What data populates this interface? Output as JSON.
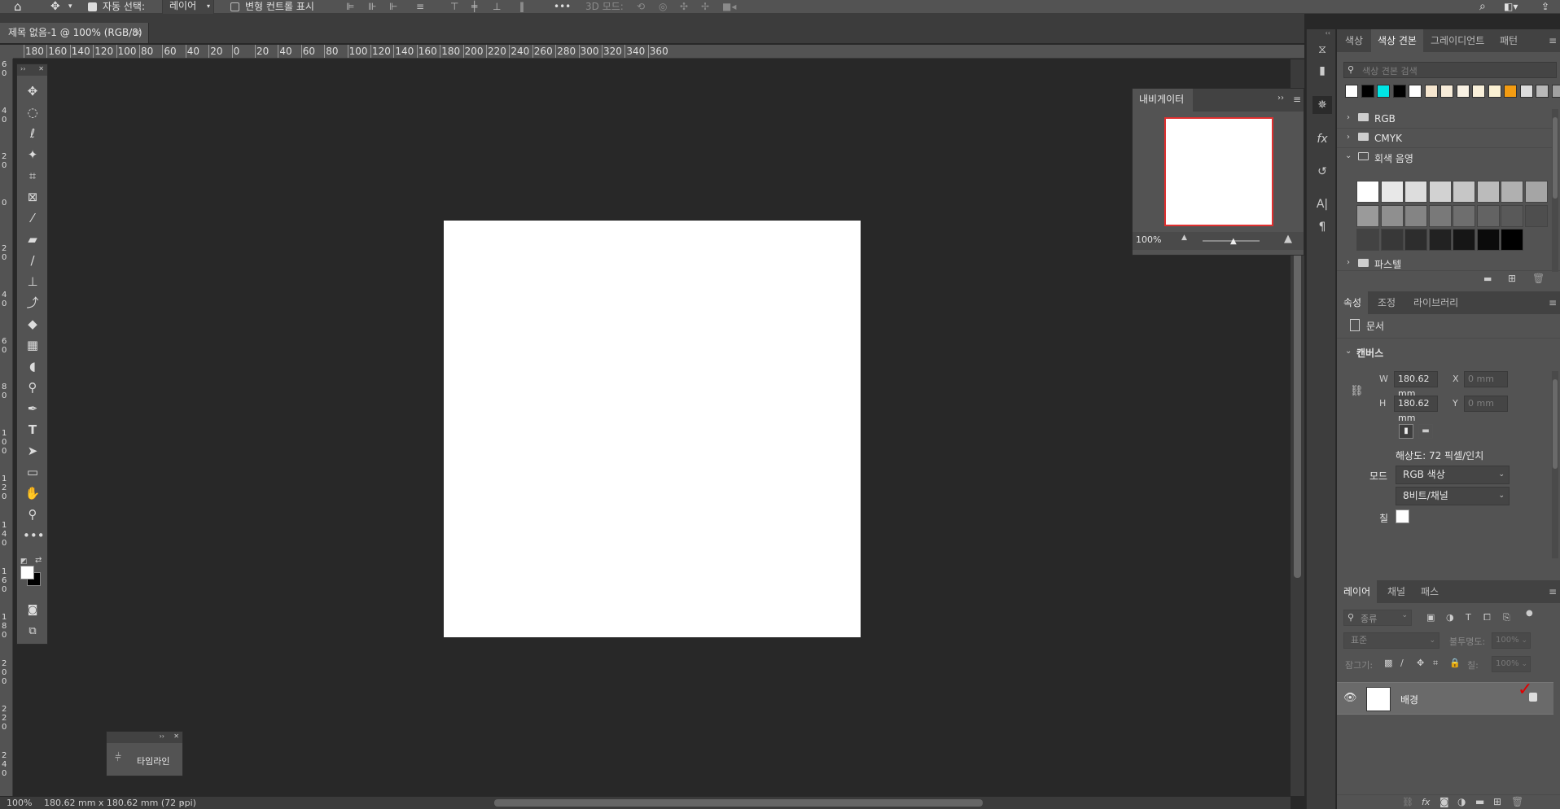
{
  "options_bar": {
    "auto_select_label": "자동 선택:",
    "auto_select_value": "레이어",
    "transform_controls_label": "변형 컨트롤 표시",
    "more_label": "•••",
    "mode_3d_label": "3D 모드:"
  },
  "document_tab": {
    "title": "제목 없음-1 @ 100% (RGB/8)",
    "close": "×"
  },
  "ruler": {
    "top_labels": [
      "180",
      "160",
      "140",
      "120",
      "100",
      "80",
      "60",
      "40",
      "20",
      "0",
      "20",
      "40",
      "60",
      "80",
      "100",
      "120",
      "140",
      "160",
      "180",
      "200",
      "220",
      "240",
      "260",
      "280",
      "300",
      "320",
      "340",
      "360"
    ],
    "left_labels": [
      "6\n0",
      "4\n0",
      "2\n0",
      "0",
      "2\n0",
      "4\n0",
      "6\n0",
      "8\n0",
      "1\n0\n0",
      "1\n2\n0",
      "1\n4\n0",
      "1\n6\n0",
      "1\n8\n0",
      "2\n0\n0",
      "2\n2\n0",
      "2\n4\n0"
    ]
  },
  "status_bar": {
    "zoom": "100%",
    "doc_size": "180.62 mm x 180.62 mm (72 ppi)"
  },
  "navigator": {
    "title": "내비게이터",
    "zoom": "100%"
  },
  "timeline": {
    "label": "타임라인"
  },
  "swatches_panel": {
    "tabs": [
      "색상",
      "색상 견본",
      "그레이디언트",
      "패턴"
    ],
    "active_tab": "색상 견본",
    "search_placeholder": "색상 견본 검색",
    "recent_colors": [
      "#ffffff",
      "#000000",
      "#00e5e5",
      "#000000",
      "#ffffff",
      "#f5e6cf",
      "#f7ecd9",
      "#f8f1e3",
      "#f9f0da",
      "#fbf1d3",
      "#f39c12",
      "#dcdcdc",
      "#b8b8b8",
      "#a0a0a0"
    ],
    "groups": [
      {
        "name": "RGB",
        "open": false
      },
      {
        "name": "CMYK",
        "open": false
      },
      {
        "name": "회색 음영",
        "open": true
      },
      {
        "name": "파스텔",
        "open": false
      }
    ],
    "gray_swatches": [
      "#ffffff",
      "#e8e8e8",
      "#dddddd",
      "#d2d2d2",
      "#c6c6c6",
      "#bbbbbb",
      "#b0b0b0",
      "#a5a5a5",
      "#9a9a9a",
      "#8f8f8f",
      "#848484",
      "#797979",
      "#6e6e6e",
      "#636363",
      "#595959",
      "#4e4e4e",
      "#434343",
      "#383838",
      "#2d2d2d",
      "#222222",
      "#161616",
      "#0b0b0b",
      "#000000"
    ]
  },
  "properties_panel": {
    "tabs": [
      "속성",
      "조정",
      "라이브러리"
    ],
    "active_tab": "속성",
    "doc_label": "문서",
    "canvas_section": "캔버스",
    "w_label": "W",
    "w_value": "180.62 mm",
    "h_label": "H",
    "h_value": "180.62 mm",
    "x_label": "X",
    "x_value": "0 mm",
    "y_label": "Y",
    "y_value": "0 mm",
    "resolution": "해상도: 72 픽셀/인치",
    "mode_label": "모드",
    "mode_value": "RGB 색상",
    "depth_value": "8비트/채널",
    "fill_label": "칠"
  },
  "layers_panel": {
    "tabs": [
      "레이어",
      "채널",
      "패스"
    ],
    "active_tab": "레이어",
    "filter_label": "종류",
    "blend_mode": "표준",
    "opacity_label": "불투명도:",
    "opacity_value": "100%",
    "lock_label": "잠그기:",
    "fill_label": "칠:",
    "fill_value": "100%",
    "layers": [
      {
        "name": "배경",
        "visible": true,
        "locked": true
      }
    ]
  }
}
